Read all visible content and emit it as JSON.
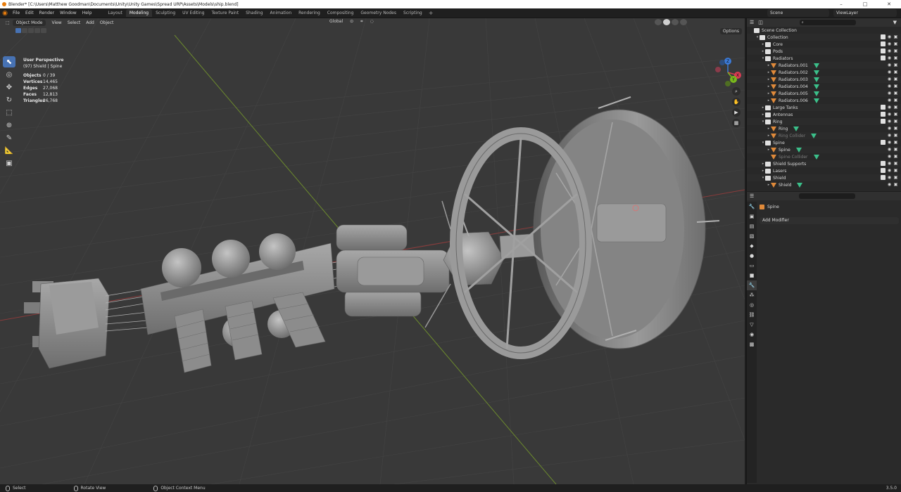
{
  "window": {
    "title": "Blender* [C:\\Users\\Matthew Goodman\\Documents\\Unity\\Unity Games\\Spread URP\\Assets\\Models\\ship.blend]",
    "minimize": "–",
    "maximize": "□",
    "close": "✕"
  },
  "menu": {
    "items": [
      "File",
      "Edit",
      "Render",
      "Window",
      "Help"
    ]
  },
  "workspaces": {
    "tabs": [
      "Layout",
      "Modeling",
      "Sculpting",
      "UV Editing",
      "Texture Paint",
      "Shading",
      "Animation",
      "Rendering",
      "Compositing",
      "Geometry Nodes",
      "Scripting"
    ],
    "active": "Modeling",
    "add_label": "+"
  },
  "scene": {
    "name": "Scene",
    "view_layer": "ViewLayer"
  },
  "viewport": {
    "mode": "Object Mode",
    "menus": [
      "View",
      "Select",
      "Add",
      "Object"
    ],
    "transform_orientation": "Global",
    "options_label": "Options",
    "perspective": "User Perspective",
    "context": "(97) Shield | Spine",
    "stats": [
      {
        "label": "Objects",
        "value": "0 / 39"
      },
      {
        "label": "Vertices",
        "value": "14,465"
      },
      {
        "label": "Edges",
        "value": "27,068"
      },
      {
        "label": "Faces",
        "value": "12,813"
      },
      {
        "label": "Triangles",
        "value": "26,768"
      }
    ],
    "gizmo": {
      "x": "X",
      "y": "Y",
      "z": "Z"
    },
    "colors": {
      "background": "#393939",
      "grid": "#444444",
      "x_axis": "#8a3b3b",
      "y_axis": "#6c8a2e",
      "model": "#8f8f8f"
    }
  },
  "outliner": {
    "search_placeholder": "",
    "rows": [
      {
        "label": "Scene Collection",
        "type": "scene",
        "indent": 0,
        "toggle": ""
      },
      {
        "label": "Collection",
        "type": "coll",
        "indent": 1,
        "toggle": "▾"
      },
      {
        "label": "Core",
        "type": "coll",
        "indent": 2,
        "toggle": "▸"
      },
      {
        "label": "Pods",
        "type": "coll",
        "indent": 2,
        "toggle": "▸"
      },
      {
        "label": "Radiators",
        "type": "coll",
        "indent": 2,
        "toggle": "▾"
      },
      {
        "label": "Radiators.001",
        "type": "mesh",
        "indent": 3,
        "toggle": "▸"
      },
      {
        "label": "Radiators.002",
        "type": "mesh",
        "indent": 3,
        "toggle": "▸"
      },
      {
        "label": "Radiators.003",
        "type": "mesh",
        "indent": 3,
        "toggle": "▸"
      },
      {
        "label": "Radiators.004",
        "type": "mesh",
        "indent": 3,
        "toggle": "▸"
      },
      {
        "label": "Radiators.005",
        "type": "mesh",
        "indent": 3,
        "toggle": "▸"
      },
      {
        "label": "Radiators.006",
        "type": "mesh",
        "indent": 3,
        "toggle": "▸"
      },
      {
        "label": "Large Tanks",
        "type": "coll",
        "indent": 2,
        "toggle": "▸"
      },
      {
        "label": "Antennas",
        "type": "coll",
        "indent": 2,
        "toggle": "▸"
      },
      {
        "label": "Ring",
        "type": "coll",
        "indent": 2,
        "toggle": "▾"
      },
      {
        "label": "Ring",
        "type": "mesh",
        "indent": 3,
        "toggle": "▸"
      },
      {
        "label": "Ring Collider",
        "type": "mesh",
        "indent": 3,
        "toggle": "▸",
        "dim": true
      },
      {
        "label": "Spine",
        "type": "coll",
        "indent": 2,
        "toggle": "▾"
      },
      {
        "label": "Spine",
        "type": "mesh",
        "indent": 3,
        "toggle": "▸"
      },
      {
        "label": "Spine Collider",
        "type": "mesh",
        "indent": 3,
        "toggle": "",
        "dim": true
      },
      {
        "label": "Shield Supports",
        "type": "coll",
        "indent": 2,
        "toggle": "▸"
      },
      {
        "label": "Lasers",
        "type": "coll",
        "indent": 2,
        "toggle": "▸"
      },
      {
        "label": "Shield",
        "type": "coll",
        "indent": 2,
        "toggle": "▾"
      },
      {
        "label": "Shield",
        "type": "mesh",
        "indent": 3,
        "toggle": "▸"
      }
    ]
  },
  "properties": {
    "object_name": "Spine",
    "add_modifier": "Add Modifier"
  },
  "statusbar": {
    "left": "Select",
    "middle": "Rotate View",
    "right": "Object Context Menu",
    "version": "3.5.0"
  }
}
